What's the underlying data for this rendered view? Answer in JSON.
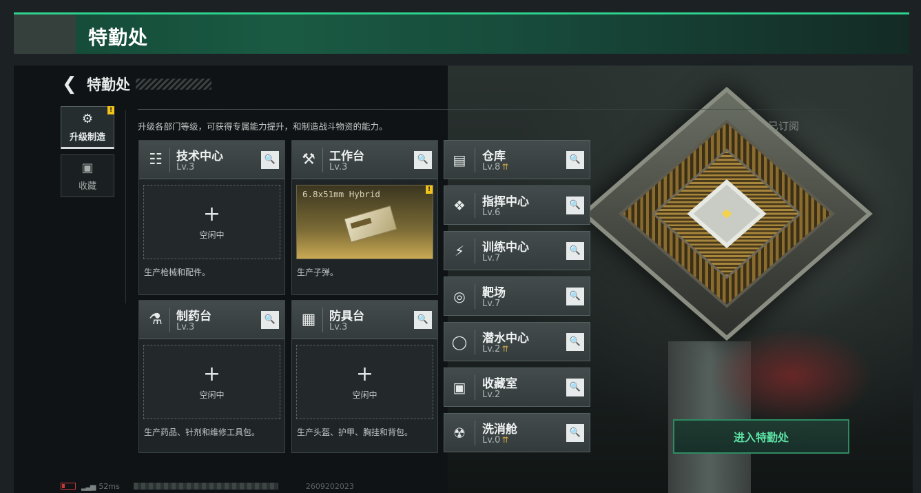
{
  "header": {
    "title": "特勤处"
  },
  "breadcrumb": {
    "back_icon": "back-arrow-icon",
    "title": "特勤处"
  },
  "side_nav": [
    {
      "label": "升级制造",
      "icon": "upgrade-icon",
      "active": true,
      "alert": "!"
    },
    {
      "label": "收藏",
      "icon": "collection-icon",
      "active": false
    }
  ],
  "description": "升级各部门等级，可获得专属能力提升，和制造战斗物资的能力。",
  "subscribed_label": "已订阅",
  "production_cards": [
    {
      "name": "技术中心",
      "level": "Lv.3",
      "icon": "tech-center-icon",
      "slot": "空闲中",
      "desc": "生产枪械和配件。"
    },
    {
      "name": "工作台",
      "level": "Lv.3",
      "icon": "workbench-icon",
      "product": "6.8x51mm Hybrid",
      "product_flag": "!",
      "desc": "生产子弹。"
    },
    {
      "name": "制药台",
      "level": "Lv.3",
      "icon": "pharmacy-icon",
      "slot": "空闲中",
      "desc": "生产药品、针剂和维修工具包。"
    },
    {
      "name": "防具台",
      "level": "Lv.3",
      "icon": "armor-bench-icon",
      "slot": "空闲中",
      "desc": "生产头盔、护甲、胸挂和背包。"
    }
  ],
  "facilities": [
    {
      "name": "仓库",
      "level": "Lv.8",
      "upgradable": true,
      "icon": "warehouse-icon"
    },
    {
      "name": "指挥中心",
      "level": "Lv.6",
      "upgradable": false,
      "icon": "command-center-icon"
    },
    {
      "name": "训练中心",
      "level": "Lv.7",
      "upgradable": false,
      "icon": "training-icon"
    },
    {
      "name": "靶场",
      "level": "Lv.7",
      "upgradable": false,
      "icon": "shooting-range-icon"
    },
    {
      "name": "潜水中心",
      "level": "Lv.2",
      "upgradable": true,
      "icon": "diving-icon"
    },
    {
      "name": "收藏室",
      "level": "Lv.2",
      "upgradable": false,
      "icon": "collection-room-icon"
    },
    {
      "name": "洗消舱",
      "level": "Lv.0",
      "upgradable": true,
      "icon": "decon-icon"
    }
  ],
  "plus_symbol": "+",
  "search_symbol": "🔍",
  "upgrade_symbol": "⇈",
  "enter_button": "进入特勤处",
  "status": {
    "ping": "52ms",
    "uid": "2609202023"
  },
  "colors": {
    "accent": "#2ed28e",
    "enter_text": "#5de2a5",
    "alert": "#f0c21b"
  }
}
